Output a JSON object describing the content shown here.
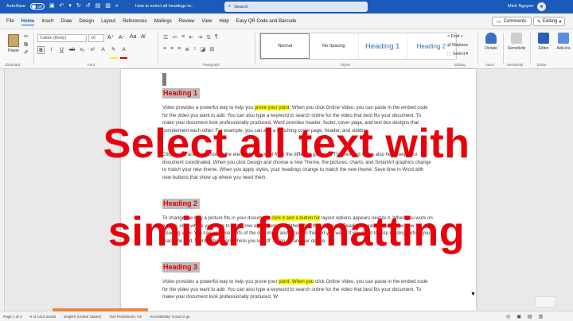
{
  "titlebar": {
    "autosave_label": "AutoSave",
    "autosave_state": "Off",
    "doc_title": "How to select all headings in...",
    "search_placeholder": "Search",
    "user_name": "Minh Nguyen"
  },
  "menu": {
    "tabs": [
      "File",
      "Home",
      "Insert",
      "Draw",
      "Design",
      "Layout",
      "References",
      "Mailings",
      "Review",
      "View",
      "Help",
      "Easy QR Code and Barcode"
    ],
    "active_tab": "Home",
    "comments_label": "Comments",
    "editing_label": "Editing"
  },
  "ribbon": {
    "paste_label": "Paste",
    "clipboard_label": "Clipboard",
    "font_name": "Calibri (Body)",
    "font_size": "10",
    "font_group_label": "Font",
    "paragraph_label": "Paragraph",
    "styles": [
      "Normal",
      "No Spacing",
      "Heading 1",
      "Heading 2"
    ],
    "styles_label": "Styles",
    "find_label": "Find",
    "replace_label": "Replace",
    "select_label": "Select",
    "editing_group_label": "Editing",
    "dictate_label": "Dictate",
    "voice_label": "Voice",
    "sensitivity_label": "Sensitivity",
    "editor_label": "Editor",
    "addins_label": "Add-ins"
  },
  "document": {
    "heading1": "Heading 1",
    "para1_before": "Video provides a powerful way to help you ",
    "para1_hl": "prove your point",
    "para1_after": ". When you click Online Video, you can paste in the embed code for the video you want to add. You can also type a keyword to search online for the video that best fits your document. To make your document look professionally produced, Word provides header, footer, cover page, and text box designs that complement each other. For example, you can add a matching cover page, header, and sidebar.",
    "para1b": "Click Insert and then choose the elements you want from the different galleries. Themes and styles also help keep your document coordinated. When you click Design and choose a new Theme, the pictures, charts, and SmartArt graphics change to match your new theme. When you apply styles, your headings change to match the new theme. Save time in Word with new buttons that show up where you need them.",
    "heading2": "Heading 2",
    "para2_before": "To change the way a picture fits in your document, ",
    "para2_hl": "click it and a button for",
    "para2_after": " layout options appears next to it. When you work on a table, click where you want to add a row or a column, and then click the plus sign. Reading is easier, too, in the new Reading view. You can collapse parts of the document and focus on the text you want. If you need to stop reading before you reach the end, Word remembers where you left off - even on another device.",
    "heading3": "Heading 3",
    "para3_before": "Video provides a powerful way to help you prove your ",
    "para3_hl": "point. When you",
    "para3_after": " click Online Video, you can paste in the embed code for the video you want to add. You can also type a keyword to search online for the video that best fits your document. To make your document look professionally produced, W"
  },
  "overlay": {
    "line1": "Select all text with",
    "line2": "similar formatting"
  },
  "status": {
    "items": [
      "Page 1 of 3",
      "6 of 1410 words",
      "English (United States)",
      "Text Predictions: On",
      "Accessibility: Good to go"
    ],
    "focus_label": "Focus"
  },
  "colors": {
    "title_blue": "#1b5ab8",
    "heading_red": "#e00000",
    "highlight": "#ffff00",
    "overlay_red": "#e8000d"
  }
}
